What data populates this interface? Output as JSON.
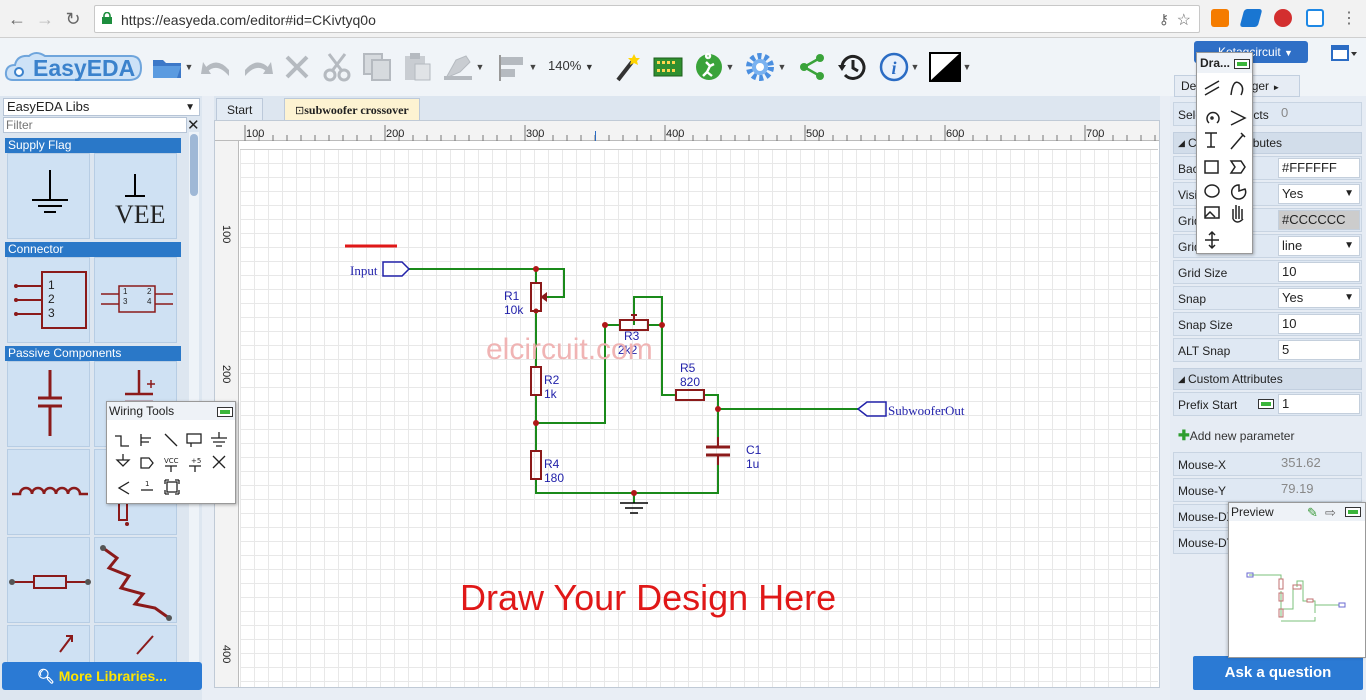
{
  "browser": {
    "url": "https://easyeda.com/editor#id=CKivtyq0o"
  },
  "toolbar": {
    "logo_text": "EasyEDA",
    "zoom": "140%",
    "user": "Kotagcircuit"
  },
  "left_panel": {
    "library_select": "EasyEDA Libs",
    "filter_placeholder": "Filter",
    "sections": [
      {
        "title": "Supply Flag"
      },
      {
        "title": "Connector"
      },
      {
        "title": "Passive Components"
      }
    ],
    "vee_label": "VEE",
    "connector_pins_a": [
      "1",
      "2",
      "3"
    ],
    "connector_pins_b": [
      "1",
      "2",
      "3",
      "4"
    ],
    "more_libraries": "More Libraries..."
  },
  "tabs": [
    {
      "label": "Start"
    },
    {
      "label": "subwoofer crossover"
    }
  ],
  "rulers": {
    "h_ticks": [
      "100",
      "200",
      "300",
      "400",
      "500",
      "600",
      "700"
    ],
    "v_ticks": [
      "100",
      "200",
      "400"
    ]
  },
  "schematic": {
    "input_label": "Input",
    "output_label": "SubwooferOut",
    "components": [
      {
        "ref": "R1",
        "value": "10k"
      },
      {
        "ref": "R2",
        "value": "1k"
      },
      {
        "ref": "R3",
        "value": "2k2"
      },
      {
        "ref": "R4",
        "value": "180"
      },
      {
        "ref": "R5",
        "value": "820"
      },
      {
        "ref": "C1",
        "value": "1u"
      }
    ],
    "watermark": "elcircuit.com",
    "headline": "Draw Your Design Here"
  },
  "wiring_tools": {
    "title": "Wiring Tools",
    "icons": [
      "wire-icon",
      "bus-icon",
      "bus-entry-icon",
      "net-label-icon",
      "net-flag-gnd-icon",
      "net-flag-port-icon",
      "net-port-icon",
      "vcc-icon",
      "plus5-icon",
      "no-connect-icon",
      "voltage-probe-icon",
      "pin-icon",
      "group-icon"
    ]
  },
  "drawing_tools": {
    "title": "Dra..."
  },
  "right_panel": {
    "tab_label": "Design Manager",
    "rows_top": [
      {
        "label": "Selected Objects",
        "value": "0"
      }
    ],
    "canvas_attributes_title": "Canvas Attributes",
    "canvas_rows": [
      {
        "label": "Background",
        "value": "#FFFFFF",
        "kind": "text"
      },
      {
        "label": "Visible Grid",
        "value": "Yes",
        "kind": "select"
      },
      {
        "label": "Grid Color",
        "value": "#CCCCCC",
        "kind": "color"
      },
      {
        "label": "Grid Style",
        "value": "line",
        "kind": "select"
      },
      {
        "label": "Grid Size",
        "value": "10",
        "kind": "text"
      },
      {
        "label": "Snap",
        "value": "Yes",
        "kind": "select"
      },
      {
        "label": "Snap Size",
        "value": "10",
        "kind": "text"
      },
      {
        "label": "ALT Snap",
        "value": "5",
        "kind": "text"
      }
    ],
    "custom_attributes_title": "Custom Attributes",
    "prefix_start_label": "Prefix Start",
    "prefix_start_value": "1",
    "add_param": "Add new parameter",
    "mouse_rows": [
      {
        "label": "Mouse-X",
        "value": "351.62"
      },
      {
        "label": "Mouse-Y",
        "value": "79.19"
      },
      {
        "label": "Mouse-DX",
        "value": ""
      },
      {
        "label": "Mouse-DY",
        "value": ""
      }
    ],
    "preview_title": "Preview",
    "ask_question": "Ask a question"
  },
  "colors": {
    "wire": "#1a8a1a",
    "component": "#8b1a1a",
    "net_label": "#2222aa",
    "headline": "#e01818",
    "watermark": "#f0b4b4",
    "accent": "#2b7ad4"
  }
}
